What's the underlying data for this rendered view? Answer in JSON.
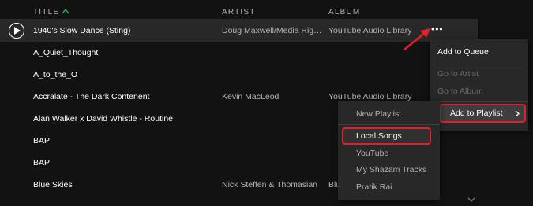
{
  "header": {
    "title": "TITLE",
    "artist": "ARTIST",
    "album": "ALBUM"
  },
  "tracks": [
    {
      "title": "1940's Slow Dance (Sting)",
      "artist": "Doug Maxwell/Media Righ...",
      "album": "YouTube Audio Library"
    },
    {
      "title": "A_Quiet_Thought",
      "artist": "",
      "album": ""
    },
    {
      "title": "A_to_the_O",
      "artist": "",
      "album": ""
    },
    {
      "title": "Accralate - The Dark Contenent",
      "artist": "Kevin MacLeod",
      "album": "YouTube Audio Library"
    },
    {
      "title": "Alan Walker x David Whistle - Routine",
      "artist": "",
      "album": ""
    },
    {
      "title": "BAP",
      "artist": "",
      "album": ""
    },
    {
      "title": "BAP",
      "artist": "",
      "album": ""
    },
    {
      "title": "Blue Skies",
      "artist": "Nick Steffen & Thomasian",
      "album": "Blu"
    }
  ],
  "more_button": "•••",
  "context_menu": {
    "items": [
      {
        "label": "Add to Queue",
        "enabled": true
      },
      {
        "label": "Go to Artist",
        "enabled": false
      },
      {
        "label": "Go to Album",
        "enabled": false
      },
      {
        "label": "Add to Playlist",
        "enabled": true
      }
    ]
  },
  "playlist_submenu": {
    "new_playlist": "New Playlist",
    "playlists": [
      "Local Songs",
      "YouTube",
      "My Shazam Tracks",
      "Pratik Rai"
    ]
  },
  "colors": {
    "background": "#121212",
    "row_hover": "#282828",
    "menu": "#282828",
    "annotation_red": "#e0202f",
    "accent_green": "#1db954"
  }
}
